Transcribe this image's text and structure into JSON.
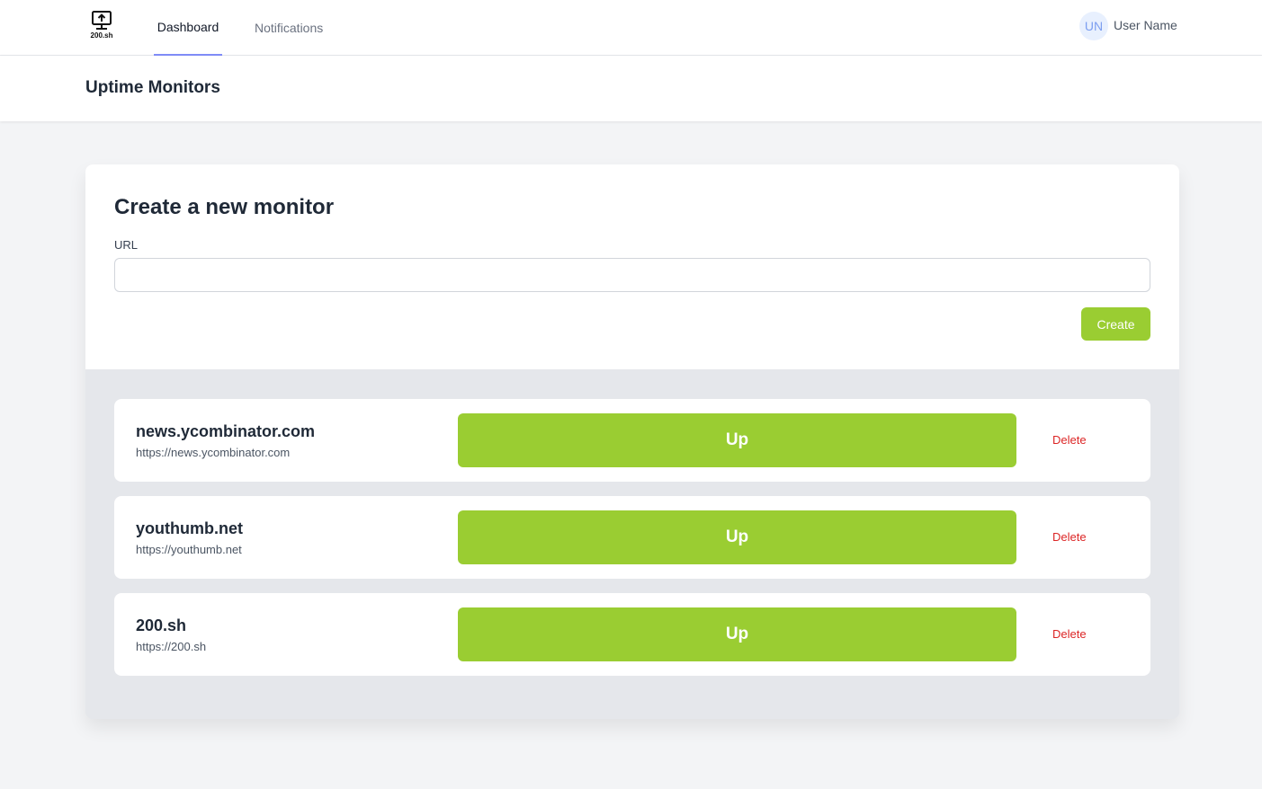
{
  "brand": {
    "logo_text": "200.sh",
    "icon": "monitor-upload-icon"
  },
  "nav": {
    "tabs": [
      {
        "label": "Dashboard",
        "active": true
      },
      {
        "label": "Notifications",
        "active": false
      }
    ],
    "accent_color": "#818cf8"
  },
  "user": {
    "initials": "UN",
    "name": "User Name"
  },
  "header": {
    "title": "Uptime Monitors"
  },
  "create_form": {
    "title": "Create a new monitor",
    "url_label": "URL",
    "url_value": "",
    "url_placeholder": "",
    "create_label": "Create"
  },
  "monitors": [
    {
      "name": "news.ycombinator.com",
      "url": "https://news.ycombinator.com",
      "status": "Up",
      "delete_label": "Delete"
    },
    {
      "name": "youthumb.net",
      "url": "https://youthumb.net",
      "status": "Up",
      "delete_label": "Delete"
    },
    {
      "name": "200.sh",
      "url": "https://200.sh",
      "status": "Up",
      "delete_label": "Delete"
    }
  ],
  "colors": {
    "status_up": "#9acd32",
    "delete": "#dc2626"
  }
}
